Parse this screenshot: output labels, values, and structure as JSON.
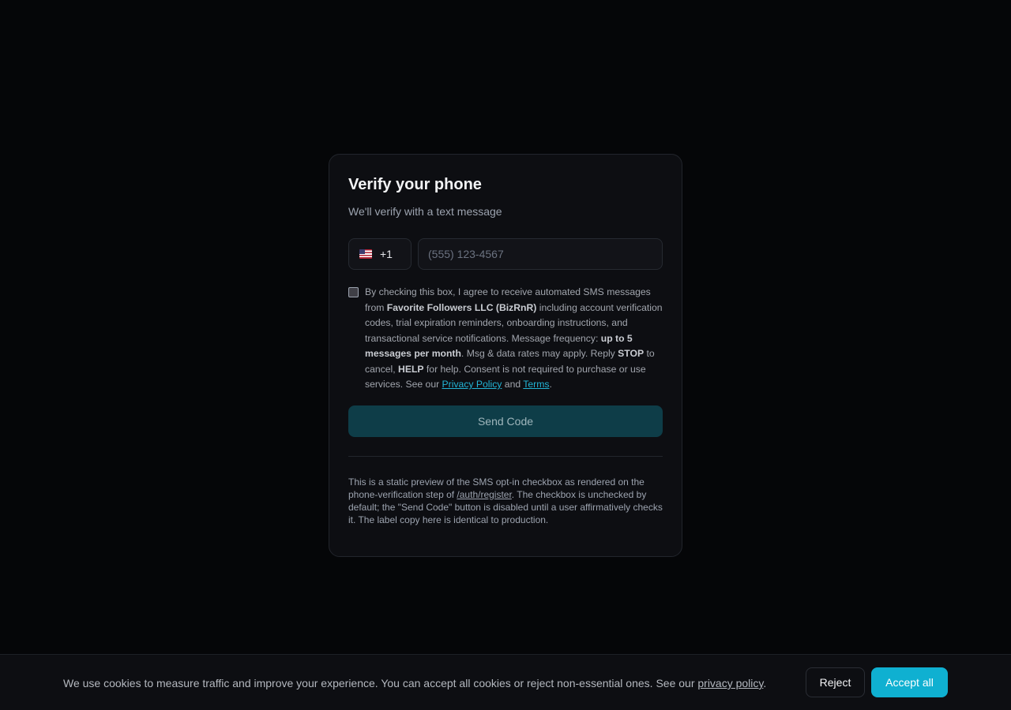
{
  "card": {
    "title": "Verify your phone",
    "subtitle": "We'll verify with a text message",
    "country_flag": "us-flag-icon",
    "country_code": "+1",
    "phone_placeholder": "(555) 123-4567",
    "checkbox_checked": false,
    "consent": {
      "t1": "By checking this box, I agree to receive automated SMS messages from ",
      "company": "Favorite Followers LLC (BizRnR)",
      "t2": " including account verification codes, trial expiration reminders, onboarding instructions, and transactional service notifications. Message frequency: ",
      "frequency": "up to 5 messages per month",
      "t3": ". Msg & data rates may apply. Reply ",
      "stop": "STOP",
      "t4": " to cancel, ",
      "help": "HELP",
      "t5": " for help. Consent is not required to purchase or use services. See our ",
      "privacy_link": "Privacy Policy",
      "t6": " and ",
      "terms_link": "Terms",
      "t7": "."
    },
    "send_button": "Send Code",
    "send_disabled": true,
    "note": {
      "t1": "This is a static preview of the SMS opt-in checkbox as rendered on the phone-verification step of ",
      "path": "/auth/register",
      "t2": ". The checkbox is unchecked by default; the \"Send Code\" button is disabled until a user affirmatively checks it. The label copy here is identical to production."
    }
  },
  "cookie_banner": {
    "text": "We use cookies to measure traffic and improve your experience. You can accept all cookies or reject non-essential ones. See our ",
    "link": "privacy policy",
    "end": ".",
    "reject_button": "Reject",
    "accept_button": "Accept all"
  },
  "colors": {
    "background": "#050608",
    "card": "#0d0e12",
    "accent": "#0fb0d1",
    "link": "#22b5d6",
    "send_disabled": "#0e3d48"
  }
}
